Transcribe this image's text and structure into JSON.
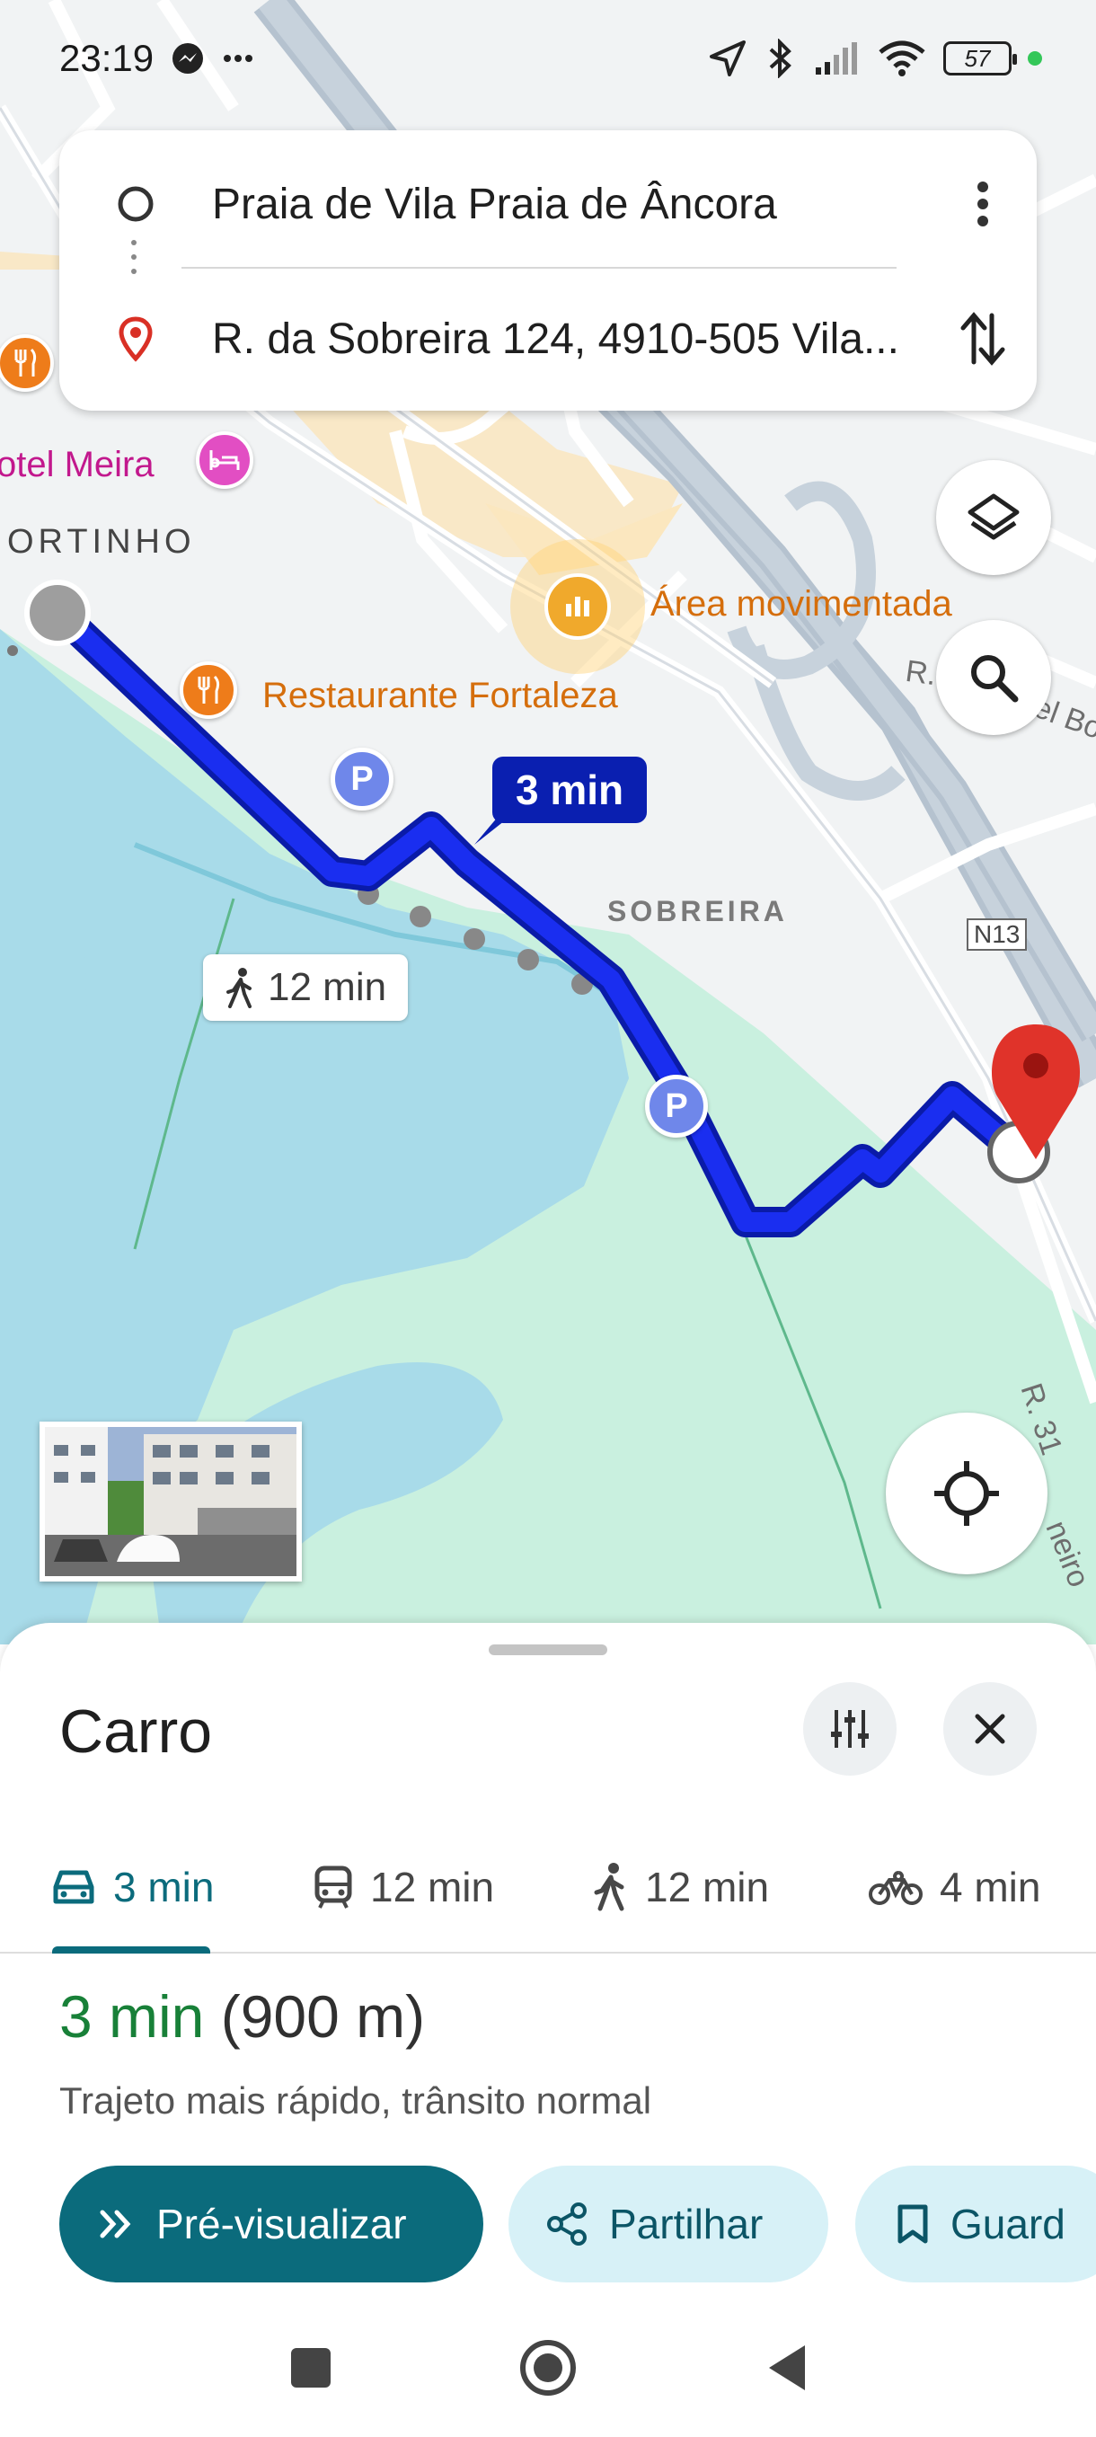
{
  "status_bar": {
    "time": "23:19",
    "battery": "57",
    "icons": [
      "messenger-icon",
      "more-dots-icon",
      "location-arrow-icon",
      "bluetooth-icon",
      "signal-icon",
      "wifi-icon",
      "battery-icon"
    ]
  },
  "route_card": {
    "origin": "Praia de Vila Praia de Âncora",
    "destination": "R. da Sobreira 124, 4910-505 Vila...",
    "icons": [
      "origin-circle-icon",
      "destination-pin-icon",
      "more-vert-icon",
      "swap-icon"
    ]
  },
  "map": {
    "labels": {
      "hotel": "otel Meira",
      "area_left": "ORTINHO",
      "busy_area": "Área movimentada",
      "restaurant": "Restaurante Fortaleza",
      "area_sobreira": "SOBREIRA",
      "road_n13": "N13",
      "street_top_right": "R. ",
      "street_top_right2": "el Bo",
      "street_right": "R. 31",
      "street_right2": "neiro"
    },
    "route_time": "3 min",
    "walk_time": "12 min",
    "colors": {
      "route": "#1a2ef0",
      "water": "#a8dbe9",
      "park": "#c9f0df",
      "beach": "#f9e5c0",
      "land": "#f1f3f4"
    }
  },
  "sheet": {
    "title": "Carro",
    "modes": [
      {
        "label": "3 min",
        "icon": "car-icon",
        "active": true
      },
      {
        "label": "12 min",
        "icon": "transit-icon",
        "active": false
      },
      {
        "label": "12 min",
        "icon": "walk-icon",
        "active": false
      },
      {
        "label": "4 min",
        "icon": "bike-icon",
        "active": false
      }
    ],
    "summary_duration": "3 min",
    "summary_distance": "(900 m)",
    "description": "Trajeto mais rápido, trânsito normal",
    "actions": {
      "preview": "Pré-visualizar",
      "share": "Partilhar",
      "save": "Guard"
    }
  }
}
